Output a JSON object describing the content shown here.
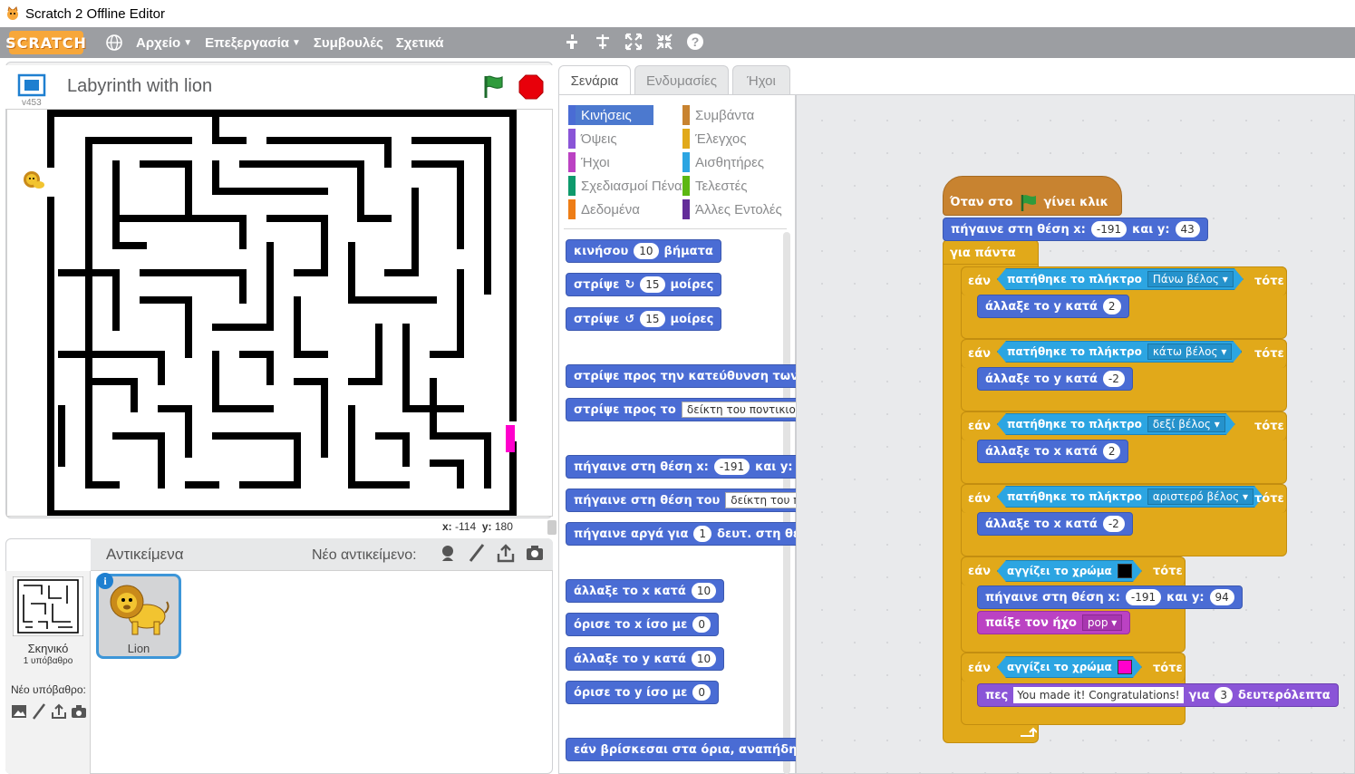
{
  "window": {
    "title": "Scratch 2 Offline Editor"
  },
  "menubar": {
    "logo": "SCRATCH",
    "items": [
      {
        "label": "Αρχείο",
        "dropdown": true
      },
      {
        "label": "Επεξεργασία",
        "dropdown": true
      },
      {
        "label": "Συμβουλές",
        "dropdown": false
      },
      {
        "label": "Σχετικά",
        "dropdown": false
      }
    ],
    "tool_icons": [
      "duplicate-icon",
      "delete-icon",
      "grow-icon",
      "shrink-icon",
      "help-icon"
    ]
  },
  "stage": {
    "project_title": "Labyrinth with lion",
    "version": "v453",
    "mouse_x_label": "x:",
    "mouse_x": "-114",
    "mouse_y_label": "y:",
    "mouse_y": "180"
  },
  "sprites": {
    "title": "Αντικείμενα",
    "new_sprite_label": "Νέο αντικείμενο:",
    "stage_label": "Σκηνικό",
    "backdrop_count": "1 υπόβαθρο",
    "new_backdrop_label": "Νέο υπόβαθρο:",
    "items": [
      {
        "name": "Lion"
      }
    ]
  },
  "tabs": [
    {
      "label": "Σενάρια",
      "active": true
    },
    {
      "label": "Ενδυμασίες",
      "active": false
    },
    {
      "label": "Ήχοι",
      "active": false
    }
  ],
  "categories": {
    "left": [
      {
        "label": "Κινήσεις",
        "color": "#4a6cd4",
        "active": true
      },
      {
        "label": "Όψεις",
        "color": "#8a55d7"
      },
      {
        "label": "Ήχοι",
        "color": "#bb42c3"
      },
      {
        "label": "Σχεδιασμοί Πένας",
        "color": "#0e9a6c"
      },
      {
        "label": "Δεδομένα",
        "color": "#ee7d16"
      }
    ],
    "right": [
      {
        "label": "Συμβάντα",
        "color": "#c88330"
      },
      {
        "label": "Έλεγχος",
        "color": "#e1a91a"
      },
      {
        "label": "Αισθητήρες",
        "color": "#2ca5e2"
      },
      {
        "label": "Τελεστές",
        "color": "#5cb712"
      },
      {
        "label": "Άλλες Εντολές",
        "color": "#632d99"
      }
    ]
  },
  "palette_blocks": [
    {
      "parts": [
        "κινήσου",
        "10",
        "βήματα"
      ]
    },
    {
      "parts": [
        "στρίψε",
        "↻",
        "15",
        "μοίρες"
      ]
    },
    {
      "parts": [
        "στρίψε",
        "↺",
        "15",
        "μοίρες"
      ]
    },
    {
      "parts": [
        "στρίψε προς την κατεύθυνση των"
      ]
    },
    {
      "parts": [
        "στρίψε προς το",
        "δείκτη του ποντικιού"
      ]
    },
    {
      "parts": [
        "πήγαινε στη θέση x:",
        "-191",
        "και y:"
      ]
    },
    {
      "parts": [
        "πήγαινε στη θέση του",
        "δείκτη του π"
      ]
    },
    {
      "parts": [
        "πήγαινε αργά για",
        "1",
        "δευτ. στη θέ"
      ]
    },
    {
      "parts": [
        "άλλαξε το x κατά",
        "10"
      ]
    },
    {
      "parts": [
        "όρισε το x ίσο με",
        "0"
      ]
    },
    {
      "parts": [
        "άλλαξε το y κατά",
        "10"
      ]
    },
    {
      "parts": [
        "όρισε το y ίσο με",
        "0"
      ]
    },
    {
      "parts": [
        "εάν βρίσκεσαι στα όρια, αναπήδη"
      ]
    }
  ],
  "script": {
    "hat": {
      "before": "Όταν στο",
      "after": "γίνει κλικ"
    },
    "goto1": {
      "label": "πήγαινε στη θέση x:",
      "x": "-191",
      "and_y": "και y:",
      "y": "43"
    },
    "forever": "για πάντα",
    "if_label": "εάν",
    "then_label": "τότε",
    "key_pressed": "πατήθηκε το πλήκτρο",
    "if_key_blocks": [
      {
        "key": "Πάνω βέλος",
        "action": "άλλαξε το y κατά",
        "value": "2"
      },
      {
        "key": "κάτω βέλος",
        "action": "άλλαξε το y κατά",
        "value": "-2"
      },
      {
        "key": "δεξί βέλος",
        "action": "άλλαξε το x κατά",
        "value": "2"
      },
      {
        "key": "αριστερό βέλος",
        "action": "άλλαξε το x κατά",
        "value": "-2"
      }
    ],
    "touching_color": "αγγίζει το χρώμα",
    "touch_black": {
      "color": "#000000",
      "goto_label": "πήγαινε στη θέση x:",
      "x": "-191",
      "and_y": "και y:",
      "y": "94",
      "play_sound": "παίξε τον ήχο",
      "sound": "pop"
    },
    "touch_pink": {
      "color": "#ff00cc",
      "say": "πες",
      "message": "You made it! Congratulations!",
      "for": "για",
      "seconds": "3",
      "seconds_label": "δευτερόλεπτα"
    }
  }
}
